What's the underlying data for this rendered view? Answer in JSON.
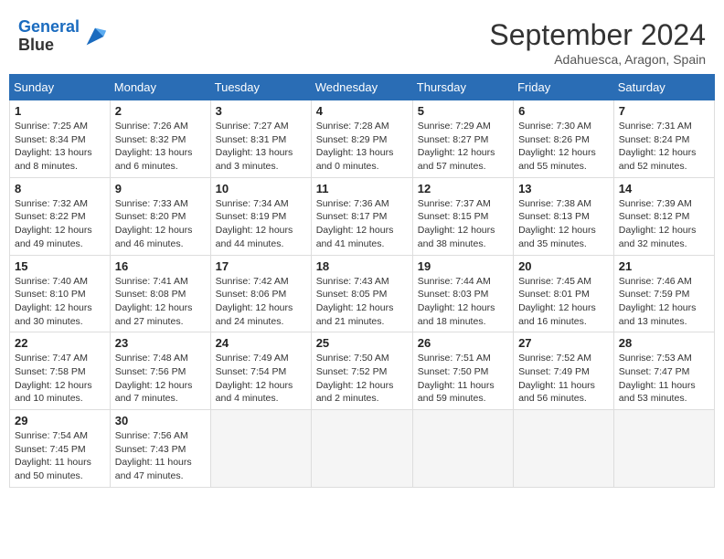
{
  "header": {
    "logo_line1": "General",
    "logo_line2": "Blue",
    "month": "September 2024",
    "location": "Adahuesca, Aragon, Spain"
  },
  "weekdays": [
    "Sunday",
    "Monday",
    "Tuesday",
    "Wednesday",
    "Thursday",
    "Friday",
    "Saturday"
  ],
  "weeks": [
    [
      {
        "day": "1",
        "sunrise": "7:25 AM",
        "sunset": "8:34 PM",
        "daylight": "13 hours and 8 minutes."
      },
      {
        "day": "2",
        "sunrise": "7:26 AM",
        "sunset": "8:32 PM",
        "daylight": "13 hours and 6 minutes."
      },
      {
        "day": "3",
        "sunrise": "7:27 AM",
        "sunset": "8:31 PM",
        "daylight": "13 hours and 3 minutes."
      },
      {
        "day": "4",
        "sunrise": "7:28 AM",
        "sunset": "8:29 PM",
        "daylight": "13 hours and 0 minutes."
      },
      {
        "day": "5",
        "sunrise": "7:29 AM",
        "sunset": "8:27 PM",
        "daylight": "12 hours and 57 minutes."
      },
      {
        "day": "6",
        "sunrise": "7:30 AM",
        "sunset": "8:26 PM",
        "daylight": "12 hours and 55 minutes."
      },
      {
        "day": "7",
        "sunrise": "7:31 AM",
        "sunset": "8:24 PM",
        "daylight": "12 hours and 52 minutes."
      }
    ],
    [
      {
        "day": "8",
        "sunrise": "7:32 AM",
        "sunset": "8:22 PM",
        "daylight": "12 hours and 49 minutes."
      },
      {
        "day": "9",
        "sunrise": "7:33 AM",
        "sunset": "8:20 PM",
        "daylight": "12 hours and 46 minutes."
      },
      {
        "day": "10",
        "sunrise": "7:34 AM",
        "sunset": "8:19 PM",
        "daylight": "12 hours and 44 minutes."
      },
      {
        "day": "11",
        "sunrise": "7:36 AM",
        "sunset": "8:17 PM",
        "daylight": "12 hours and 41 minutes."
      },
      {
        "day": "12",
        "sunrise": "7:37 AM",
        "sunset": "8:15 PM",
        "daylight": "12 hours and 38 minutes."
      },
      {
        "day": "13",
        "sunrise": "7:38 AM",
        "sunset": "8:13 PM",
        "daylight": "12 hours and 35 minutes."
      },
      {
        "day": "14",
        "sunrise": "7:39 AM",
        "sunset": "8:12 PM",
        "daylight": "12 hours and 32 minutes."
      }
    ],
    [
      {
        "day": "15",
        "sunrise": "7:40 AM",
        "sunset": "8:10 PM",
        "daylight": "12 hours and 30 minutes."
      },
      {
        "day": "16",
        "sunrise": "7:41 AM",
        "sunset": "8:08 PM",
        "daylight": "12 hours and 27 minutes."
      },
      {
        "day": "17",
        "sunrise": "7:42 AM",
        "sunset": "8:06 PM",
        "daylight": "12 hours and 24 minutes."
      },
      {
        "day": "18",
        "sunrise": "7:43 AM",
        "sunset": "8:05 PM",
        "daylight": "12 hours and 21 minutes."
      },
      {
        "day": "19",
        "sunrise": "7:44 AM",
        "sunset": "8:03 PM",
        "daylight": "12 hours and 18 minutes."
      },
      {
        "day": "20",
        "sunrise": "7:45 AM",
        "sunset": "8:01 PM",
        "daylight": "12 hours and 16 minutes."
      },
      {
        "day": "21",
        "sunrise": "7:46 AM",
        "sunset": "7:59 PM",
        "daylight": "12 hours and 13 minutes."
      }
    ],
    [
      {
        "day": "22",
        "sunrise": "7:47 AM",
        "sunset": "7:58 PM",
        "daylight": "12 hours and 10 minutes."
      },
      {
        "day": "23",
        "sunrise": "7:48 AM",
        "sunset": "7:56 PM",
        "daylight": "12 hours and 7 minutes."
      },
      {
        "day": "24",
        "sunrise": "7:49 AM",
        "sunset": "7:54 PM",
        "daylight": "12 hours and 4 minutes."
      },
      {
        "day": "25",
        "sunrise": "7:50 AM",
        "sunset": "7:52 PM",
        "daylight": "12 hours and 2 minutes."
      },
      {
        "day": "26",
        "sunrise": "7:51 AM",
        "sunset": "7:50 PM",
        "daylight": "11 hours and 59 minutes."
      },
      {
        "day": "27",
        "sunrise": "7:52 AM",
        "sunset": "7:49 PM",
        "daylight": "11 hours and 56 minutes."
      },
      {
        "day": "28",
        "sunrise": "7:53 AM",
        "sunset": "7:47 PM",
        "daylight": "11 hours and 53 minutes."
      }
    ],
    [
      {
        "day": "29",
        "sunrise": "7:54 AM",
        "sunset": "7:45 PM",
        "daylight": "11 hours and 50 minutes."
      },
      {
        "day": "30",
        "sunrise": "7:56 AM",
        "sunset": "7:43 PM",
        "daylight": "11 hours and 47 minutes."
      },
      null,
      null,
      null,
      null,
      null
    ]
  ]
}
